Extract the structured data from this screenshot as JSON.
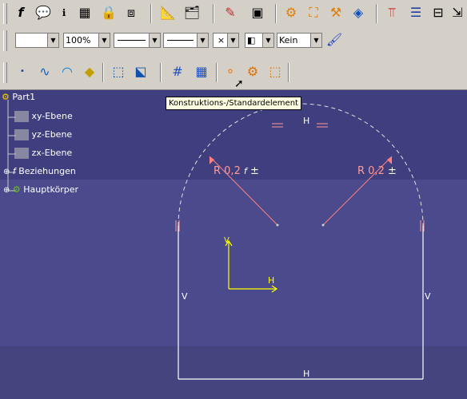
{
  "toolbar": {
    "zoom_value": "100%",
    "layer_value": "Kein",
    "tooltip": "Konstruktions-/Standardelement"
  },
  "tree": {
    "root": "Part1",
    "items": [
      "xy-Ebene",
      "yz-Ebene",
      "zx-Ebene",
      "Beziehungen",
      "Hauptkörper"
    ]
  },
  "sketch": {
    "radius_label_left": "R 0,2",
    "radius_label_right": "R 0,2",
    "plusminus": "±",
    "constraint_h": "H",
    "constraint_v": "V",
    "axis_v": "V",
    "axis_h": "H"
  },
  "colors": {
    "toolbar_bg": "#d4d0c8",
    "canvas_bg": "#4a4a8c",
    "sketch_white": "#ffffff",
    "dimension": "#ff8080",
    "axis": "#ffff00",
    "constraint": "#ff9999"
  }
}
